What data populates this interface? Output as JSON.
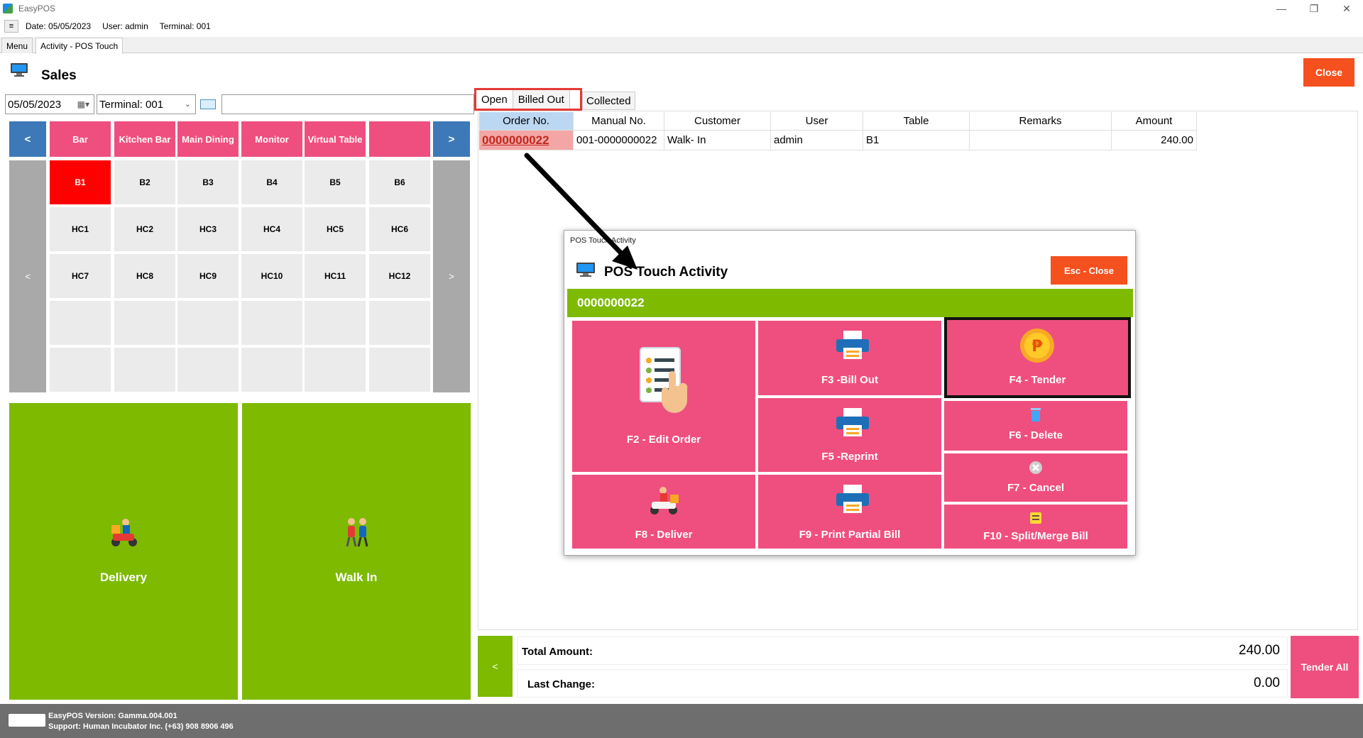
{
  "app": {
    "title": "EasyPOS"
  },
  "infobar": {
    "menu_glyph": "≡",
    "date": "Date: 05/05/2023",
    "user": "User: admin",
    "terminal": "Terminal: 001"
  },
  "tabs": [
    "Menu",
    "Activity - POS Touch"
  ],
  "header": {
    "title": "Sales",
    "close_label": "Close"
  },
  "filters": {
    "date": "05/05/2023",
    "terminal": "Terminal: 001",
    "search_value": ""
  },
  "status_tabs": [
    "Open",
    "Billed Out",
    "Collected"
  ],
  "table": {
    "columns": [
      "Order No.",
      "Manual No.",
      "Customer",
      "User",
      "Table",
      "Remarks",
      "Amount"
    ],
    "rows": [
      {
        "order_no": "0000000022",
        "manual_no": "001-0000000022",
        "customer": "Walk- In",
        "user": "admin",
        "table": "B1",
        "remarks": "",
        "amount": "240.00"
      }
    ]
  },
  "categories": {
    "prev": "<",
    "next": ">",
    "items": [
      "Bar",
      "Kitchen Bar",
      "Main Dining",
      "Monitor",
      "Virtual Table",
      ""
    ]
  },
  "tables_nav": {
    "prev": "<",
    "next": ">"
  },
  "tables": [
    "B1",
    "B2",
    "B3",
    "B4",
    "B5",
    "B6",
    "HC1",
    "HC2",
    "HC3",
    "HC4",
    "HC5",
    "HC6",
    "HC7",
    "HC8",
    "HC9",
    "HC10",
    "HC11",
    "HC12"
  ],
  "modes": {
    "delivery": "Delivery",
    "walkin": "Walk In"
  },
  "summary": {
    "back": "<",
    "total_label": "Total Amount:",
    "total_value": "240.00",
    "change_label": "Last Change:",
    "change_value": "0.00",
    "tender_all": "Tender All"
  },
  "footer": {
    "version": "EasyPOS Version: Gamma.004.001",
    "support": "Support: Human Incubator Inc. (+63) 908 8906 496"
  },
  "modal": {
    "window_title": "POS Touch Activity",
    "heading": "POS Touch Activity",
    "close_label": "Esc - Close",
    "order_no": "0000000022",
    "actions": {
      "edit_order": "F2 - Edit Order",
      "bill_out": "F3 -Bill Out",
      "tender": "F4 - Tender",
      "reprint": "F5 -Reprint",
      "delete": "F6 - Delete",
      "cancel": "F7 - Cancel",
      "deliver": "F8 - Deliver",
      "print_partial": "F9 - Print Partial Bill",
      "split_merge": "F10 - Split/Merge Bill"
    }
  },
  "colors": {
    "pink": "#ef4f7f",
    "green": "#7dba00",
    "orange": "#f4511e",
    "blue": "#3d79b8",
    "active_table": "#ff0000"
  }
}
